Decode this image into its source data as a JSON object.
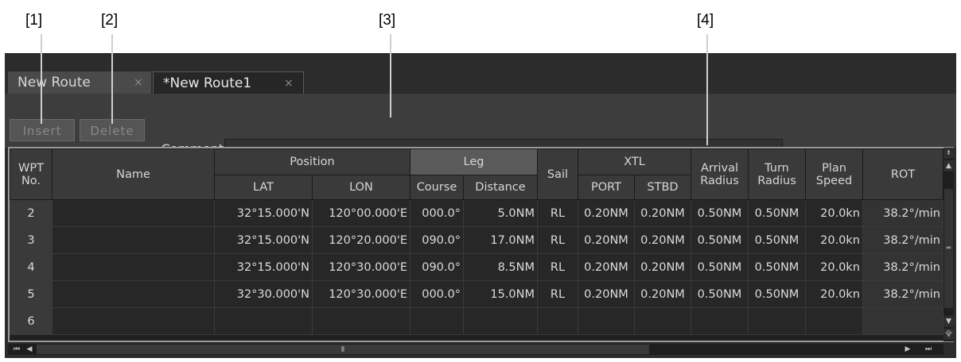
{
  "callouts": [
    "[1]",
    "[2]",
    "[3]",
    "[4]"
  ],
  "tabs": [
    {
      "label": "New Route",
      "close": "×"
    },
    {
      "label": "*New Route1",
      "close": "×"
    }
  ],
  "toolbar": {
    "insert_label": "Insert",
    "delete_label": "Delete",
    "comment_label": "Comment",
    "comment_value": ""
  },
  "table": {
    "headers": {
      "wpt": "WPT No.",
      "name": "Name",
      "position": "Position",
      "lat": "LAT",
      "lon": "LON",
      "leg": "Leg",
      "course": "Course",
      "distance": "Distance",
      "sail": "Sail",
      "xtl": "XTL",
      "port": "PORT",
      "stbd": "STBD",
      "arrival_radius": "Arrival Radius",
      "turn_radius": "Turn Radius",
      "plan_speed": "Plan Speed",
      "rot": "ROT"
    },
    "rows": [
      {
        "wpt": "2",
        "name": "",
        "lat": "32°15.000'N",
        "lon": "120°00.000'E",
        "course": "000.0°",
        "distance": "5.0NM",
        "sail": "RL",
        "port": "0.20NM",
        "stbd": "0.20NM",
        "arrival": "0.50NM",
        "turn": "0.50NM",
        "speed": "20.0kn",
        "rot": "38.2°/min"
      },
      {
        "wpt": "3",
        "name": "",
        "lat": "32°15.000'N",
        "lon": "120°20.000'E",
        "course": "090.0°",
        "distance": "17.0NM",
        "sail": "RL",
        "port": "0.20NM",
        "stbd": "0.20NM",
        "arrival": "0.50NM",
        "turn": "0.50NM",
        "speed": "20.0kn",
        "rot": "38.2°/min"
      },
      {
        "wpt": "4",
        "name": "",
        "lat": "32°15.000'N",
        "lon": "120°30.000'E",
        "course": "090.0°",
        "distance": "8.5NM",
        "sail": "RL",
        "port": "0.20NM",
        "stbd": "0.20NM",
        "arrival": "0.50NM",
        "turn": "0.50NM",
        "speed": "20.0kn",
        "rot": "38.2°/min"
      },
      {
        "wpt": "5",
        "name": "",
        "lat": "32°30.000'N",
        "lon": "120°30.000'E",
        "course": "000.0°",
        "distance": "15.0NM",
        "sail": "RL",
        "port": "0.20NM",
        "stbd": "0.20NM",
        "arrival": "0.50NM",
        "turn": "0.50NM",
        "speed": "20.0kn",
        "rot": "38.2°/min"
      },
      {
        "wpt": "6",
        "name": "",
        "lat": "",
        "lon": "",
        "course": "",
        "distance": "",
        "sail": "",
        "port": "",
        "stbd": "",
        "arrival": "",
        "turn": "",
        "speed": "",
        "rot": ""
      }
    ]
  },
  "scroll": {
    "up_top": "⯒",
    "up": "▲",
    "grip": "═",
    "down": "▼",
    "down_bottom": "⯓",
    "first": "⏮",
    "left": "◀",
    "hgrip": "⦀",
    "right": "▶",
    "last": "⏭"
  },
  "colors": {
    "panel": "#2c2c2c",
    "header": "#3a3a3a",
    "cell": "#272727",
    "text": "#dcdcdc"
  }
}
